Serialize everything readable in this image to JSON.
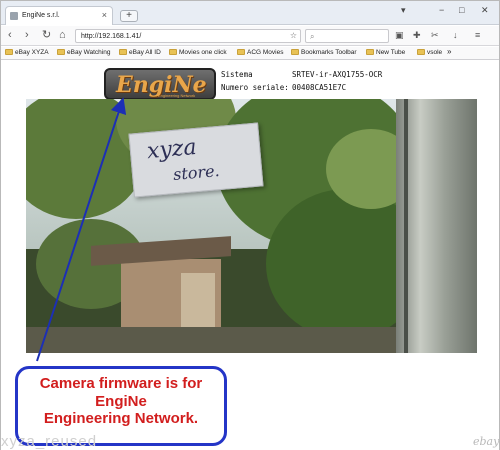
{
  "browser": {
    "tab_title": "EngiNe s.r.l.",
    "tab_close": "×",
    "new_tab": "+",
    "url": "http://192.168.1.41/",
    "search_placeholder": ""
  },
  "bookmarks": [
    {
      "label": "eBay XYZA"
    },
    {
      "label": "eBay Watching"
    },
    {
      "label": "eBay All ID"
    },
    {
      "label": "Movies one click"
    },
    {
      "label": "ACG Movies"
    },
    {
      "label": "Bookmarks Toolbar"
    },
    {
      "label": "New Tube"
    },
    {
      "label": "vsole"
    }
  ],
  "page": {
    "logo_text": "EngiNe",
    "logo_sub": "Engineering Network",
    "sistema_label": "Sistema",
    "sistema_value": "SRTEV-ir-AXQ1755-OCR",
    "serial_label": "Numero seriale:",
    "serial_value": "00408CA51E7C",
    "note_line1": "xyza",
    "note_line2": "store."
  },
  "callout": {
    "line1": "Camera firmware is for",
    "line2": "EngiNe",
    "line3": "Engineering Network."
  },
  "overlay": {
    "watermark": "xyza_reused",
    "ebay_mark": "ebay"
  },
  "colors": {
    "callout_border": "#2435c7",
    "callout_text": "#d21e1e",
    "arrow": "#1c2fb5"
  }
}
